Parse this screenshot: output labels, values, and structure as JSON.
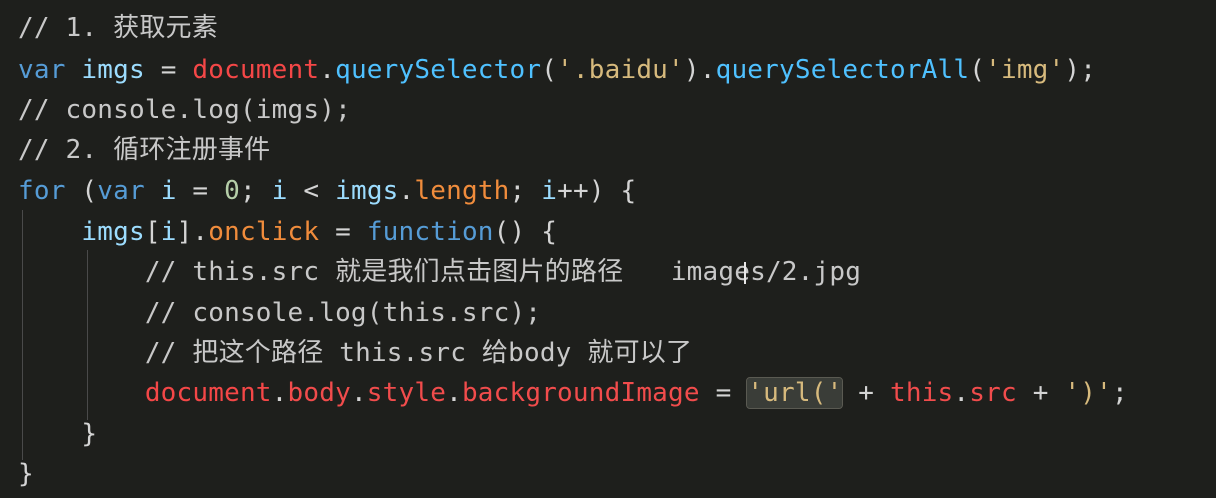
{
  "editor": {
    "lines": [
      [
        {
          "t": "// 1. 获取元素",
          "c": "c-comment"
        }
      ],
      [
        {
          "t": "var",
          "c": "c-kw"
        },
        {
          "t": " ",
          "c": "c-plain"
        },
        {
          "t": "imgs",
          "c": "c-var"
        },
        {
          "t": " = ",
          "c": "c-plain"
        },
        {
          "t": "document",
          "c": "c-global"
        },
        {
          "t": ".",
          "c": "c-plain"
        },
        {
          "t": "querySelector",
          "c": "c-method"
        },
        {
          "t": "(",
          "c": "c-plain"
        },
        {
          "t": "'.baidu'",
          "c": "c-str"
        },
        {
          "t": ").",
          "c": "c-plain"
        },
        {
          "t": "querySelectorAll",
          "c": "c-method"
        },
        {
          "t": "(",
          "c": "c-plain"
        },
        {
          "t": "'img'",
          "c": "c-str"
        },
        {
          "t": ");",
          "c": "c-plain"
        }
      ],
      [
        {
          "t": "// console.log(imgs);",
          "c": "c-comment"
        }
      ],
      [
        {
          "t": "// 2. 循环注册事件",
          "c": "c-comment"
        }
      ],
      [
        {
          "t": "for",
          "c": "c-kw"
        },
        {
          "t": " (",
          "c": "c-plain"
        },
        {
          "t": "var",
          "c": "c-kw"
        },
        {
          "t": " ",
          "c": "c-plain"
        },
        {
          "t": "i",
          "c": "c-var"
        },
        {
          "t": " = ",
          "c": "c-plain"
        },
        {
          "t": "0",
          "c": "c-num"
        },
        {
          "t": "; ",
          "c": "c-plain"
        },
        {
          "t": "i",
          "c": "c-var"
        },
        {
          "t": " < ",
          "c": "c-plain"
        },
        {
          "t": "imgs",
          "c": "c-var"
        },
        {
          "t": ".",
          "c": "c-plain"
        },
        {
          "t": "length",
          "c": "c-orange"
        },
        {
          "t": "; ",
          "c": "c-plain"
        },
        {
          "t": "i",
          "c": "c-var"
        },
        {
          "t": "++) {",
          "c": "c-plain"
        }
      ],
      [
        {
          "t": "    ",
          "c": "c-plain"
        },
        {
          "t": "imgs",
          "c": "c-var"
        },
        {
          "t": "[",
          "c": "c-plain"
        },
        {
          "t": "i",
          "c": "c-var"
        },
        {
          "t": "].",
          "c": "c-plain"
        },
        {
          "t": "onclick",
          "c": "c-orange"
        },
        {
          "t": " = ",
          "c": "c-plain"
        },
        {
          "t": "function",
          "c": "c-kw"
        },
        {
          "t": "() {",
          "c": "c-plain"
        }
      ],
      [
        {
          "t": "        ",
          "c": "c-plain"
        },
        {
          "t": "// this.src 就是我们点击图片的路径   images/2.jpg",
          "c": "c-comment"
        }
      ],
      [
        {
          "t": "        ",
          "c": "c-plain"
        },
        {
          "t": "// console.log(this.src);",
          "c": "c-comment"
        }
      ],
      [
        {
          "t": "        ",
          "c": "c-plain"
        },
        {
          "t": "// 把这个路径 this.src 给body 就可以了",
          "c": "c-comment"
        }
      ],
      [
        {
          "t": "        ",
          "c": "c-plain"
        },
        {
          "t": "document",
          "c": "c-global"
        },
        {
          "t": ".",
          "c": "c-plain"
        },
        {
          "t": "body",
          "c": "c-red"
        },
        {
          "t": ".",
          "c": "c-plain"
        },
        {
          "t": "style",
          "c": "c-red"
        },
        {
          "t": ".",
          "c": "c-plain"
        },
        {
          "t": "backgroundImage",
          "c": "c-red"
        },
        {
          "t": " = ",
          "c": "c-plain"
        },
        {
          "t": "'url('",
          "c": "c-str",
          "hl": true
        },
        {
          "t": " + ",
          "c": "c-plain"
        },
        {
          "t": "this",
          "c": "c-red"
        },
        {
          "t": ".",
          "c": "c-plain"
        },
        {
          "t": "src",
          "c": "c-red"
        },
        {
          "t": " + ",
          "c": "c-plain"
        },
        {
          "t": "')'",
          "c": "c-str"
        },
        {
          "t": ";",
          "c": "c-plain"
        }
      ],
      [
        {
          "t": "    }",
          "c": "c-plain"
        }
      ],
      [
        {
          "t": "}",
          "c": "c-plain"
        }
      ]
    ]
  }
}
